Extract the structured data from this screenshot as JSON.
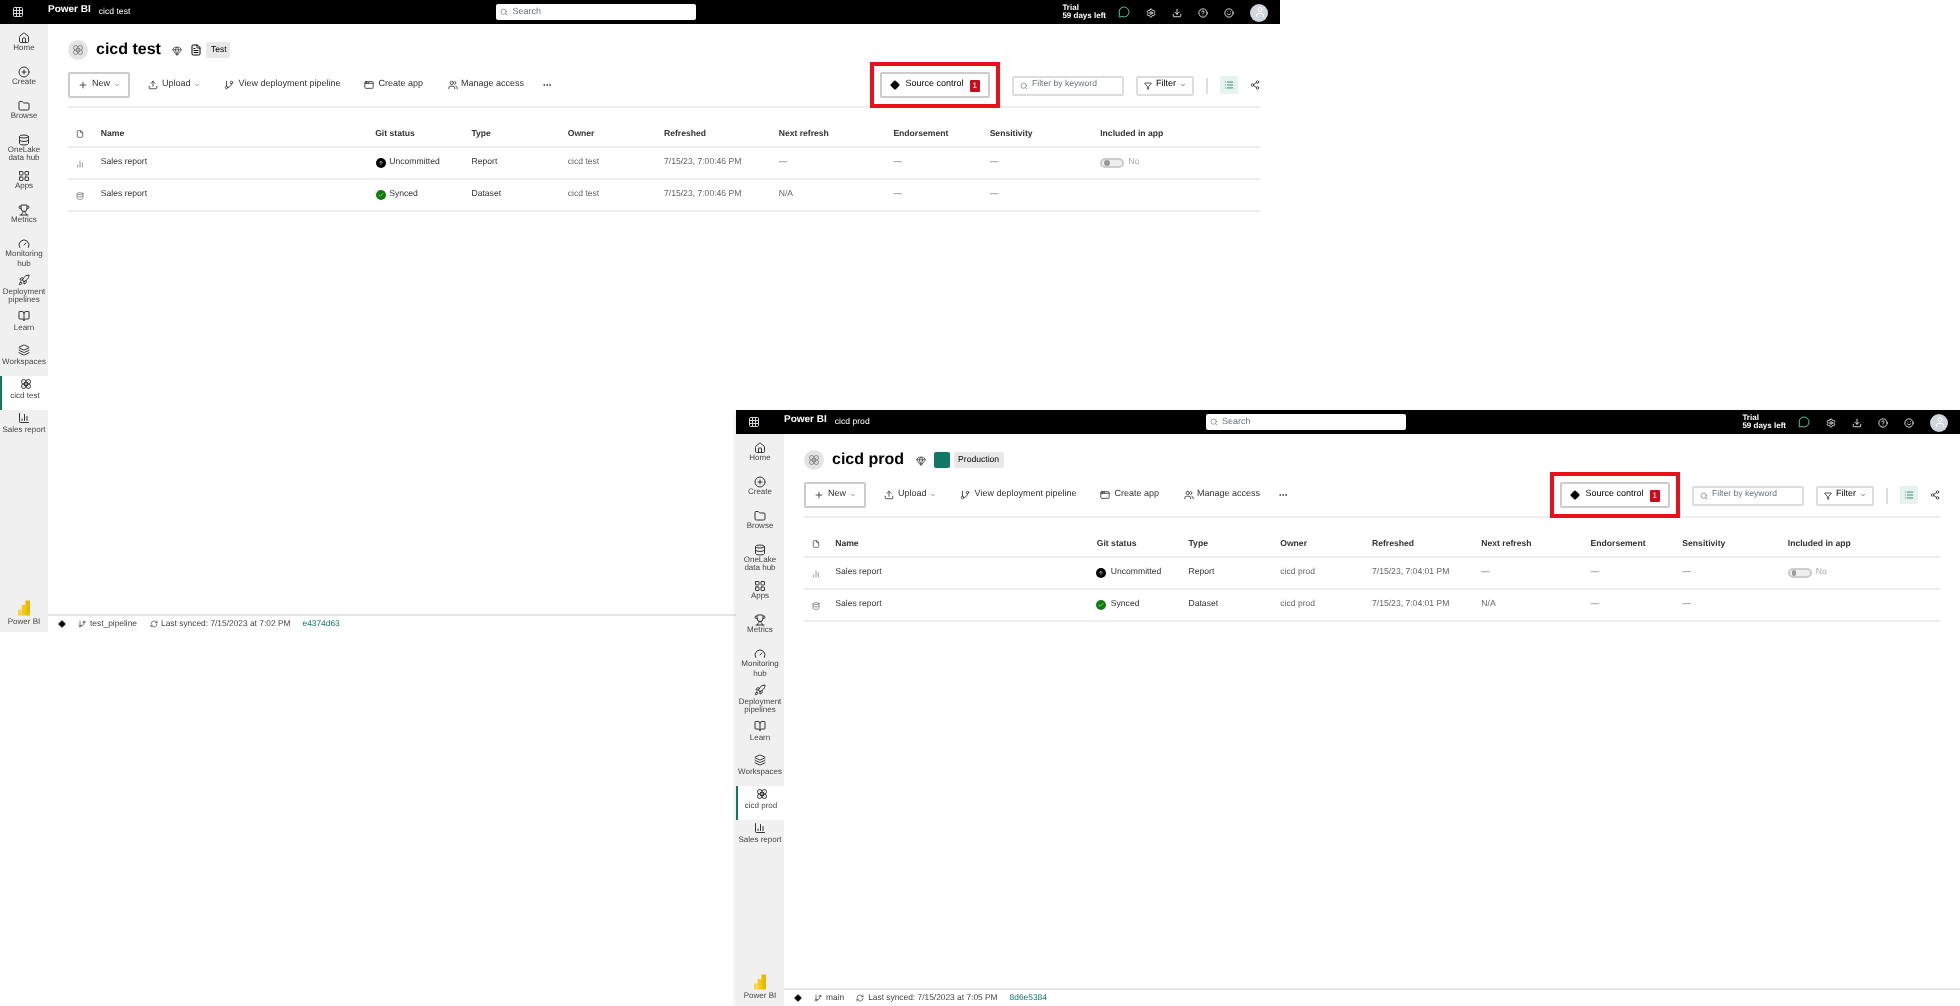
{
  "windows": [
    {
      "app_name": "Power BI",
      "workspace_crumb": "cicd test",
      "search": {
        "placeholder": "Search"
      },
      "trial": {
        "title": "Trial",
        "days": "59 days left"
      },
      "sidebar": {
        "items": [
          {
            "label": "Home",
            "selected": false
          },
          {
            "label": "Create",
            "selected": false
          },
          {
            "label": "Browse",
            "selected": false
          },
          {
            "label": "OneLake data hub",
            "selected": false
          },
          {
            "label": "Apps",
            "selected": false
          },
          {
            "label": "Metrics",
            "selected": false
          },
          {
            "label": "Monitoring hub",
            "selected": false
          },
          {
            "label": "Deployment pipelines",
            "selected": false
          },
          {
            "label": "Learn",
            "selected": false
          },
          {
            "label": "Workspaces",
            "selected": false
          },
          {
            "label": "cicd test",
            "selected": true
          },
          {
            "label": "Sales report",
            "selected": false
          }
        ],
        "logo_label": "Power BI"
      },
      "workspace": {
        "title": "cicd test",
        "tag": {
          "label": "Test",
          "kind": "test"
        }
      },
      "toolbar": [
        {
          "label": "New",
          "kind": "outlined"
        },
        {
          "label": "Upload",
          "kind": "dropdown"
        },
        {
          "label": "View deployment pipeline",
          "kind": "plain"
        },
        {
          "label": "Create app",
          "kind": "plain"
        },
        {
          "label": "Manage access",
          "kind": "plain"
        }
      ],
      "source_control": {
        "label": "Source control",
        "badge": "1",
        "highlighted": true
      },
      "filter": {
        "placeholder": "Filter by keyword",
        "button": "Filter"
      },
      "table": {
        "columns": [
          "Name",
          "Git status",
          "Type",
          "Owner",
          "Refreshed",
          "Next refresh",
          "Endorsement",
          "Sensitivity",
          "Included in app"
        ],
        "rows": [
          {
            "kind": "report",
            "name": "Sales report",
            "git_status": {
              "label": "Uncommitted",
              "kind": "uncommitted"
            },
            "type": "Report",
            "owner": "cicd test",
            "refreshed": "7/15/23, 7:00:46 PM",
            "next_refresh": "—",
            "endorsement": "—",
            "sensitivity": "—",
            "included_in_app": {
              "on": false,
              "label": "No"
            }
          },
          {
            "kind": "dataset",
            "name": "Sales report",
            "git_status": {
              "label": "Synced",
              "kind": "synced"
            },
            "type": "Dataset",
            "owner": "cicd test",
            "refreshed": "7/15/23, 7:00:46 PM",
            "next_refresh": "N/A",
            "endorsement": "—",
            "sensitivity": "—"
          }
        ]
      },
      "status_bar": {
        "branch": "test_pipeline",
        "last_synced": "Last synced: 7/15/2023 at 7:02 PM",
        "commit": "e4374d63"
      }
    },
    {
      "app_name": "Power BI",
      "workspace_crumb": "cicd prod",
      "search": {
        "placeholder": "Search"
      },
      "trial": {
        "title": "Trial",
        "days": "59 days left"
      },
      "sidebar": {
        "items": [
          {
            "label": "Home",
            "selected": false
          },
          {
            "label": "Create",
            "selected": false
          },
          {
            "label": "Browse",
            "selected": false
          },
          {
            "label": "OneLake data hub",
            "selected": false
          },
          {
            "label": "Apps",
            "selected": false
          },
          {
            "label": "Metrics",
            "selected": false
          },
          {
            "label": "Monitoring hub",
            "selected": false
          },
          {
            "label": "Deployment pipelines",
            "selected": false
          },
          {
            "label": "Learn",
            "selected": false
          },
          {
            "label": "Workspaces",
            "selected": false
          },
          {
            "label": "cicd prod",
            "selected": true
          },
          {
            "label": "Sales report",
            "selected": false
          }
        ],
        "logo_label": "Power BI"
      },
      "workspace": {
        "title": "cicd prod",
        "tag": {
          "label": "Production",
          "kind": "production"
        }
      },
      "toolbar": [
        {
          "label": "New",
          "kind": "outlined"
        },
        {
          "label": "Upload",
          "kind": "dropdown"
        },
        {
          "label": "View deployment pipeline",
          "kind": "plain"
        },
        {
          "label": "Create app",
          "kind": "plain"
        },
        {
          "label": "Manage access",
          "kind": "plain"
        }
      ],
      "source_control": {
        "label": "Source control",
        "badge": "1",
        "highlighted": true
      },
      "filter": {
        "placeholder": "Filter by keyword",
        "button": "Filter"
      },
      "table": {
        "columns": [
          "Name",
          "Git status",
          "Type",
          "Owner",
          "Refreshed",
          "Next refresh",
          "Endorsement",
          "Sensitivity",
          "Included in app"
        ],
        "rows": [
          {
            "kind": "report",
            "name": "Sales report",
            "git_status": {
              "label": "Uncommitted",
              "kind": "uncommitted"
            },
            "type": "Report",
            "owner": "cicd prod",
            "refreshed": "7/15/23, 7:04:01 PM",
            "next_refresh": "—",
            "endorsement": "—",
            "sensitivity": "—",
            "included_in_app": {
              "on": false,
              "label": "No"
            }
          },
          {
            "kind": "dataset",
            "name": "Sales report",
            "git_status": {
              "label": "Synced",
              "kind": "synced"
            },
            "type": "Dataset",
            "owner": "cicd prod",
            "refreshed": "7/15/23, 7:04:01 PM",
            "next_refresh": "N/A",
            "endorsement": "—",
            "sensitivity": "—"
          }
        ]
      },
      "status_bar": {
        "branch": "main",
        "last_synced": "Last synced: 7/15/2023 at 7:05 PM",
        "commit": "8d6e5384"
      }
    }
  ]
}
